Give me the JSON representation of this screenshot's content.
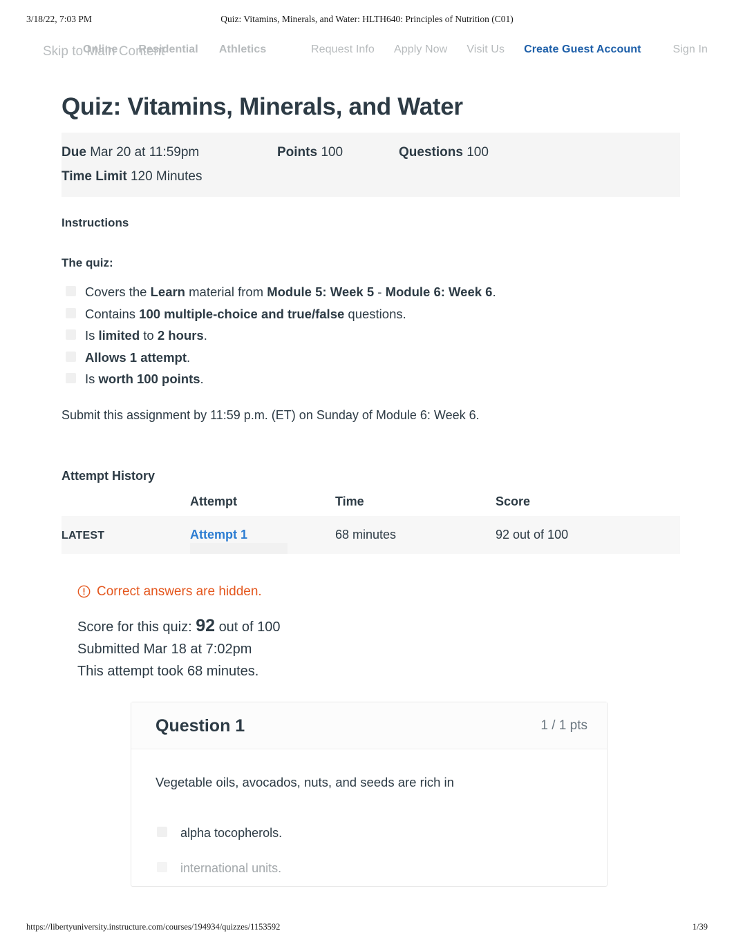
{
  "print": {
    "timestamp": "3/18/22, 7:03 PM",
    "doc_title": "Quiz: Vitamins, Minerals, and Water: HLTH640: Principles of Nutrition (C01)",
    "footer_url": "https://libertyuniversity.instructure.com/courses/194934/quizzes/1153592",
    "page_number": "1/39"
  },
  "nav": {
    "skip_link": "Skip to Main Content",
    "left_items": [
      {
        "label": "Online"
      },
      {
        "label": "Residential"
      },
      {
        "label": "Athletics"
      }
    ],
    "right_items": [
      {
        "label": "Request Info",
        "style": "plain"
      },
      {
        "label": "Apply Now",
        "style": "plain"
      },
      {
        "label": "Visit Us",
        "style": "plain"
      },
      {
        "label": "Create Guest Account",
        "style": "accent"
      }
    ],
    "sign_in": "Sign In",
    "accent_color": "#1c5ea8"
  },
  "quiz": {
    "title": "Quiz: Vitamins, Minerals, and Water",
    "meta": {
      "due_label": "Due",
      "due_value": "Mar 20 at 11:59pm",
      "points_label": "Points",
      "points_value": "100",
      "questions_label": "Questions",
      "questions_value": "100",
      "time_limit_label": "Time Limit",
      "time_limit_value": "120 Minutes"
    },
    "instructions_heading": "Instructions",
    "lead": "The quiz:",
    "bullets": [
      {
        "parts": [
          {
            "t": "Covers the ",
            "b": false
          },
          {
            "t": "Learn",
            "b": true
          },
          {
            "t": " material from ",
            "b": false
          },
          {
            "t": "Module 5: Week 5",
            "b": true
          },
          {
            "t": " - ",
            "b": false
          },
          {
            "t": "Module 6: Week 6",
            "b": true
          },
          {
            "t": ".",
            "b": false
          }
        ]
      },
      {
        "parts": [
          {
            "t": "Contains ",
            "b": false
          },
          {
            "t": "100 multiple-choice and true/false",
            "b": true
          },
          {
            "t": " questions.",
            "b": false
          }
        ]
      },
      {
        "parts": [
          {
            "t": "Is ",
            "b": false
          },
          {
            "t": "limited",
            "b": true
          },
          {
            "t": " to ",
            "b": false
          },
          {
            "t": "2 hours",
            "b": true
          },
          {
            "t": ".",
            "b": false
          }
        ]
      },
      {
        "parts": [
          {
            "t": "Allows 1 attempt",
            "b": true
          },
          {
            "t": ".",
            "b": false
          }
        ]
      },
      {
        "parts": [
          {
            "t": "Is ",
            "b": false
          },
          {
            "t": "worth 100 points",
            "b": true
          },
          {
            "t": ".",
            "b": false
          }
        ]
      }
    ],
    "submit_note": "Submit this assignment by 11:59 p.m. (ET) on Sunday of Module 6: Week 6."
  },
  "attempt_history": {
    "heading": "Attempt History",
    "columns": [
      "",
      "Attempt",
      "Time",
      "Score"
    ],
    "rows": [
      {
        "kept": "LATEST",
        "attempt": "Attempt 1",
        "time": "68 minutes",
        "score": "92 out of 100"
      }
    ],
    "link_color": "#2d7dd2"
  },
  "result": {
    "hidden_notice": "Correct answers are hidden.",
    "hidden_notice_color": "#e4571e",
    "score_prefix": "Score for this quiz:",
    "score_value": "92",
    "score_suffix": "out of 100",
    "submitted": "Submitted Mar 18 at 7:02pm",
    "duration": "This attempt took 68 minutes."
  },
  "question": {
    "title": "Question 1",
    "points": "1 / 1 pts",
    "text": "Vegetable oils, avocados, nuts, and seeds are rich in",
    "answers": [
      {
        "label": "alpha tocopherols.",
        "dim": false
      },
      {
        "label": "international units.",
        "dim": true
      }
    ]
  }
}
